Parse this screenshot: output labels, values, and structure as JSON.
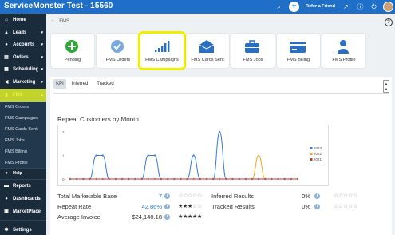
{
  "app": {
    "title": "ServiceMonster Test - 15560"
  },
  "topbar": {
    "refer_label": "Refer a Friend"
  },
  "sidebar": {
    "items": [
      {
        "label": "Home",
        "icon": "home-icon",
        "glyph": "⌂"
      },
      {
        "label": "Leads",
        "icon": "leads-icon",
        "glyph": "▲"
      },
      {
        "label": "Accounts",
        "icon": "accounts-icon",
        "glyph": "●"
      },
      {
        "label": "Orders",
        "icon": "orders-icon",
        "glyph": "▤"
      },
      {
        "label": "Scheduling",
        "icon": "calendar-icon",
        "glyph": "▦"
      },
      {
        "label": "Marketing",
        "icon": "megaphone-icon",
        "glyph": "◀"
      },
      {
        "label": "FMS",
        "icon": "signal-icon",
        "glyph": "▮"
      }
    ],
    "sub_items": [
      "FMS Orders",
      "FMS Campaigns",
      "FMS Cards Sent",
      "FMS Jobs",
      "FMS Billing",
      "FMS Profile"
    ],
    "bottom_items": [
      {
        "label": "Help",
        "icon": "help-icon",
        "glyph": "●"
      },
      {
        "label": "Reports",
        "icon": "reports-icon",
        "glyph": "▬"
      },
      {
        "label": "Dashboards",
        "icon": "dashboard-icon",
        "glyph": "◕"
      },
      {
        "label": "MarketPlace",
        "icon": "store-icon",
        "glyph": "▣"
      },
      {
        "label": "Settings",
        "icon": "gear-icon",
        "glyph": "✱"
      }
    ]
  },
  "breadcrumb": {
    "current": "FMS"
  },
  "tiles": [
    {
      "label": "Pending",
      "icon": "plus-circle-icon",
      "color": "#2ea836"
    },
    {
      "label": "FMS Orders",
      "icon": "check-circle-icon",
      "color": "#7aa9e0"
    },
    {
      "label": "FMS Campaigns",
      "icon": "signal-bars-icon",
      "color": "#2a6fc4"
    },
    {
      "label": "FMS Cards Sent",
      "icon": "envelope-icon",
      "color": "#2a6fc4"
    },
    {
      "label": "FMS Jobs",
      "icon": "briefcase-icon",
      "color": "#2a6fc4"
    },
    {
      "label": "FMS Billing",
      "icon": "credit-card-icon",
      "color": "#2a6fc4"
    },
    {
      "label": "FMS Profile",
      "icon": "person-icon",
      "color": "#2a6fc4"
    }
  ],
  "tabs": [
    "KPI",
    "Inferred",
    "Tracked"
  ],
  "chart_data": {
    "type": "line",
    "title": "Repeat Customers by Month",
    "ylim": [
      0,
      2
    ],
    "yticks": [
      "0",
      "1",
      "2"
    ],
    "x": [
      1,
      2,
      3,
      4,
      5,
      6,
      7,
      8,
      9,
      10,
      11,
      12,
      13,
      14,
      15,
      16,
      17,
      18,
      19,
      20,
      21,
      22,
      23,
      24,
      25,
      26,
      27,
      28,
      29,
      30,
      31,
      32,
      33,
      34,
      35,
      36
    ],
    "series": [
      {
        "name": "2023",
        "color": "#3b7dd8",
        "values": [
          0,
          0,
          0,
          0,
          1,
          1,
          0,
          0,
          0,
          0,
          0,
          0,
          1,
          1,
          0,
          0,
          0,
          0,
          0,
          1,
          0,
          0,
          0,
          2,
          0,
          0,
          0,
          0,
          0,
          0,
          0,
          0,
          0,
          0,
          0,
          0
        ]
      },
      {
        "name": "2022",
        "color": "#f5a623",
        "values": [
          0,
          0,
          0,
          0,
          0,
          0,
          0,
          0,
          0,
          0,
          0,
          0,
          0,
          0,
          0,
          0,
          0,
          0,
          0,
          0,
          0,
          0,
          0,
          0,
          0,
          0,
          0,
          0,
          0,
          1,
          0,
          0,
          0,
          0,
          0,
          0
        ]
      },
      {
        "name": "2021",
        "color": "#d0342c",
        "values": [
          0,
          0,
          0,
          0,
          0,
          0,
          0,
          0,
          0,
          0,
          0,
          0,
          0,
          0,
          0,
          0,
          0,
          0,
          0,
          0,
          0,
          0,
          0,
          0,
          0,
          0,
          0,
          0,
          0,
          0,
          0,
          0,
          0,
          0,
          0,
          0
        ]
      }
    ]
  },
  "kpis": {
    "total_base_label": "Total Marketable Base",
    "total_base_value": "7",
    "repeat_rate_label": "Repeat Rate",
    "repeat_rate_value": "42.86%",
    "avg_invoice_label": "Average Invoice",
    "avg_invoice_value": "$24,140.18",
    "inferred_label": "Inferred Results",
    "inferred_value": "0%",
    "tracked_label": "Tracked Results",
    "tracked_value": "0%",
    "stars_total": 0,
    "stars_repeat": 3,
    "stars_avg": 5,
    "stars_inferred": 0,
    "stars_tracked": 0
  }
}
